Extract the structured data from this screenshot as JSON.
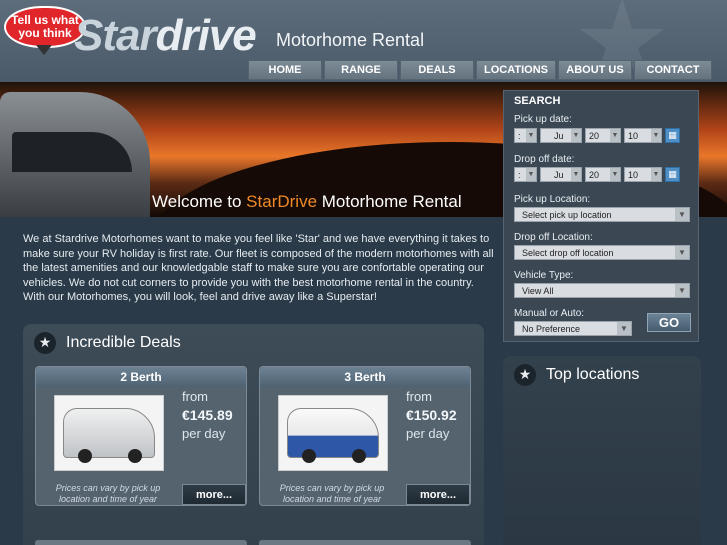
{
  "header": {
    "bubble_line1": "Tell us what",
    "bubble_line2": "you think",
    "logo_star": "Star",
    "logo_drive": "drive",
    "tagline": "Motorhome Rental"
  },
  "nav": {
    "items": [
      {
        "label": "HOME"
      },
      {
        "label": "RANGE"
      },
      {
        "label": "DEALS"
      },
      {
        "label": "LOCATIONS"
      },
      {
        "label": "ABOUT US"
      },
      {
        "label": "CONTACT"
      }
    ]
  },
  "hero": {
    "welcome_prefix": "Welcome to ",
    "welcome_brand": "StarDrive",
    "welcome_suffix": " Motorhome Rental"
  },
  "intro": {
    "text": "We at Stardrive Motorhomes want to make you feel like 'Star' and we have everything it takes to make sure your RV holiday is first rate. Our fleet is composed of the modern motorhomes with all the latest amenities and our knowledgable staff to make sure you are confortable operating our vehicles. We do not cut corners to provide you with the best motorhome rental in the country. With our Motorhomes, you will look, feel and drive away like a Superstar!"
  },
  "search": {
    "title": "SEARCH",
    "pickup_date_label": "Pick up date:",
    "pickup": {
      "time": ":",
      "month": "Ju",
      "day": "20",
      "year": "10"
    },
    "dropoff_date_label": "Drop off date:",
    "dropoff": {
      "time": ":",
      "month": "Ju",
      "day": "20",
      "year": "10"
    },
    "pickup_location_label": "Pick up Location:",
    "pickup_location_value": "Select pick up location",
    "dropoff_location_label": "Drop off Location:",
    "dropoff_location_value": "Select drop off location",
    "vehicle_type_label": "Vehicle Type:",
    "vehicle_type_value": "View All",
    "manual_auto_label": "Manual or Auto:",
    "manual_auto_value": "No Preference",
    "go_label": "GO"
  },
  "top_locations": {
    "title": "Top locations"
  },
  "deals": {
    "title": "Incredible Deals",
    "cards": [
      {
        "name": "2 Berth",
        "from": "from",
        "price": "€145.89",
        "per": "per day",
        "note": "Prices can vary by pick up location and time of year",
        "more": "more..."
      },
      {
        "name": "3 Berth",
        "from": "from",
        "price": "€150.92",
        "per": "per day",
        "note": "Prices can vary by pick up location and time of year",
        "more": "more..."
      }
    ]
  },
  "colors": {
    "accent_orange": "#f08a28",
    "bubble_red": "#e0262b",
    "background": "#2a3a48",
    "calendar_blue": "#4f8fc6"
  },
  "icons": [
    "star-icon",
    "calendar-icon",
    "chevron-down-icon"
  ]
}
